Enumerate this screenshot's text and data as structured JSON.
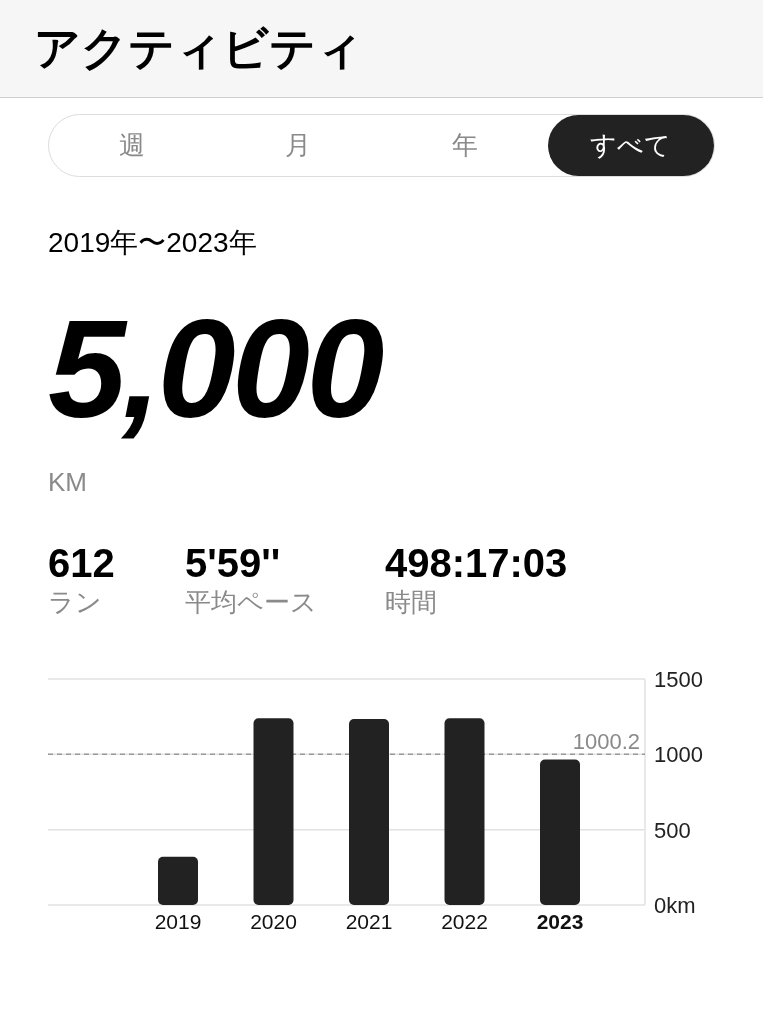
{
  "header": {
    "title": "アクティビティ"
  },
  "tabs": [
    {
      "label": "週",
      "selected": false
    },
    {
      "label": "月",
      "selected": false
    },
    {
      "label": "年",
      "selected": false
    },
    {
      "label": "すべて",
      "selected": true
    }
  ],
  "period": "2019年〜2023年",
  "total": {
    "value": "5,000",
    "unit": "KM"
  },
  "stats": [
    {
      "value": "612",
      "label": "ラン"
    },
    {
      "value": "5'59''",
      "label": "平均ペース"
    },
    {
      "value": "498:17:03",
      "label": "時間"
    }
  ],
  "chart": {
    "category_selected": [
      false,
      false,
      false,
      false,
      true
    ],
    "chart_data": {
      "type": "bar",
      "categories": [
        "2019",
        "2020",
        "2021",
        "2022",
        "2023"
      ],
      "series": [
        {
          "color": "#222222",
          "values": [
            320,
            1240,
            1235,
            1240,
            965
          ]
        }
      ],
      "ylim": [
        0,
        1500
      ],
      "yticks": [
        {
          "value": 0,
          "label": "0km"
        },
        500,
        1000,
        1500
      ],
      "ref_lines": [
        {
          "axis": "y",
          "value": 1000.2,
          "label": "1000.2"
        }
      ]
    }
  }
}
